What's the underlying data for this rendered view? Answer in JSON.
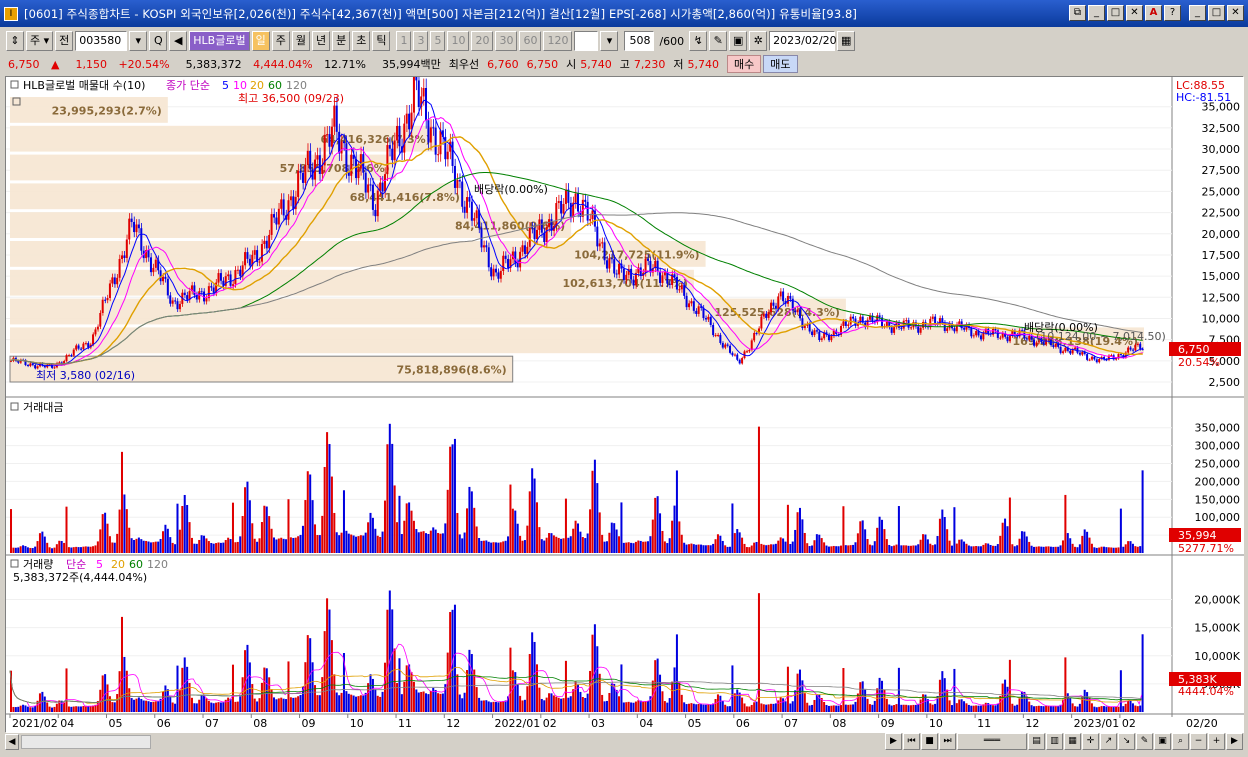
{
  "window": {
    "title": "[0601] 주식종합차트 - KOSPI 외국인보유[2,026(천)] 주식수[42,367(천)] 액면[500] 자본금[212(억)] 결산[12월] EPS[-268] 시가총액[2,860(억)] 유통비율[93.8]",
    "buttons": [
      "⧉",
      "_",
      "□",
      "✕",
      "A",
      "?",
      "_",
      "□",
      "✕"
    ]
  },
  "toolbar": {
    "period_type": "주",
    "prev": "전",
    "code": "003580",
    "stock_name": "HLB글로벌",
    "period_buttons": [
      "일",
      "주",
      "월",
      "년",
      "분",
      "초",
      "틱"
    ],
    "interval_buttons": [
      "1",
      "3",
      "5",
      "10",
      "20",
      "30",
      "60",
      "120"
    ],
    "count": "508",
    "count_total": "/600",
    "date": "2023/02/20"
  },
  "quote": {
    "price": "6,750",
    "arrow": "▲",
    "change": "1,150",
    "change_pct": "+20.54%",
    "volume": "5,383,372",
    "volume_pct": "4,444.04%",
    "turnover": "12.71%",
    "amount": "35,994백만",
    "best_label": "최우선",
    "ask": "6,760",
    "bid": "6,750",
    "open_label": "시",
    "open": "5,740",
    "high_label": "고",
    "high": "7,230",
    "low_label": "저",
    "low": "5,740",
    "buy": "매수",
    "sell": "매도"
  },
  "price_panel": {
    "legend_name": "HLB글로벌 매물대 수(10)",
    "legend_ma": "종가 단순",
    "ma_periods": [
      "5",
      "10",
      "20",
      "60",
      "120"
    ],
    "ma_colors": [
      "#0000ff",
      "#ff00ff",
      "#e0a000",
      "#008000",
      "#808080"
    ],
    "lc": "LC:88.55",
    "hc": "HC:-81.51",
    "max_label": "최고 36,500 (09/23)",
    "min_label": "최저 3,580 (02/16)",
    "dividend_labels": [
      "배당락(0.00%)",
      "배당락(0.00%)"
    ],
    "last_price": "6,750",
    "last_pct": "20.54%",
    "volume_profile": [
      "23,995,293(2.7%)",
      "64,416,326(7.3%)",
      "84,411,860(9.6%)",
      "57,855,708(6.6%)",
      "68,441,416(7.8%)",
      "104,217,725(11.9%)",
      "102,613,704(11.7%)",
      "125,525,628(14.3%)",
      "169,268,138(19.4%)",
      "75,818,896(8.6%)"
    ],
    "ma_note": "(10,124.00 ~ 7,014.50)",
    "y_ticks": [
      "35,000",
      "32,500",
      "30,000",
      "27,500",
      "25,000",
      "22,500",
      "20,000",
      "17,500",
      "15,000",
      "12,500",
      "10,000",
      "7,500",
      "5,000",
      "2,500"
    ]
  },
  "amount_panel": {
    "title": "거래대금",
    "last": "35,994",
    "last_pct": "5277.71%",
    "y_ticks": [
      "350,000",
      "300,000",
      "250,000",
      "200,000",
      "150,000",
      "100,000",
      "50,000"
    ]
  },
  "volume_panel": {
    "title": "거래량",
    "ma_label": "단순",
    "ma_periods": [
      "5",
      "20",
      "60",
      "120"
    ],
    "value_text": "5,383,372주(4,444.04%)",
    "last": "5,383K",
    "last_pct": "4444.04%",
    "y_ticks": [
      "20,000K",
      "15,000K",
      "10,000K",
      "5,000K"
    ]
  },
  "x_axis": {
    "labels": [
      "2021/02",
      "04",
      "05",
      "06",
      "07",
      "08",
      "09",
      "10",
      "11",
      "12",
      "2022/01",
      "02",
      "03",
      "04",
      "05",
      "06",
      "07",
      "08",
      "09",
      "10",
      "11",
      "12",
      "2023/01",
      "02"
    ],
    "end_label": "02/20"
  },
  "chart_data": {
    "type": "candlestick",
    "series_price_anchor_points": [
      {
        "x": "2021/02",
        "y": 5000
      },
      {
        "x": "2021/03",
        "y": 4200
      },
      {
        "x": "2021/04",
        "y": 7500
      },
      {
        "x": "2021/04",
        "y": 21000
      },
      {
        "x": "2021/05",
        "y": 12000
      },
      {
        "x": "2021/06",
        "y": 13500
      },
      {
        "x": "2021/07",
        "y": 17000
      },
      {
        "x": "2021/07",
        "y": 25000
      },
      {
        "x": "2021/08",
        "y": 32000
      },
      {
        "x": "2021/08",
        "y": 24000
      },
      {
        "x": "2021/09",
        "y": 36500
      },
      {
        "x": "2021/10",
        "y": 27000
      },
      {
        "x": "2021/11",
        "y": 15000
      },
      {
        "x": "2021/12",
        "y": 20000
      },
      {
        "x": "2022/01",
        "y": 24500
      },
      {
        "x": "2022/02",
        "y": 15000
      },
      {
        "x": "2022/03",
        "y": 16000
      },
      {
        "x": "2022/04",
        "y": 11000
      },
      {
        "x": "2022/05",
        "y": 4700
      },
      {
        "x": "2022/05",
        "y": 13000
      },
      {
        "x": "2022/06",
        "y": 7500
      },
      {
        "x": "2022/07",
        "y": 10000
      },
      {
        "x": "2022/08",
        "y": 9000
      },
      {
        "x": "2022/09",
        "y": 9500
      },
      {
        "x": "2022/10",
        "y": 8200
      },
      {
        "x": "2022/11",
        "y": 8000
      },
      {
        "x": "2022/12",
        "y": 6500
      },
      {
        "x": "2023/01",
        "y": 5000
      },
      {
        "x": "2023/02",
        "y": 6750
      }
    ],
    "ylim": [
      2500,
      36500
    ]
  }
}
